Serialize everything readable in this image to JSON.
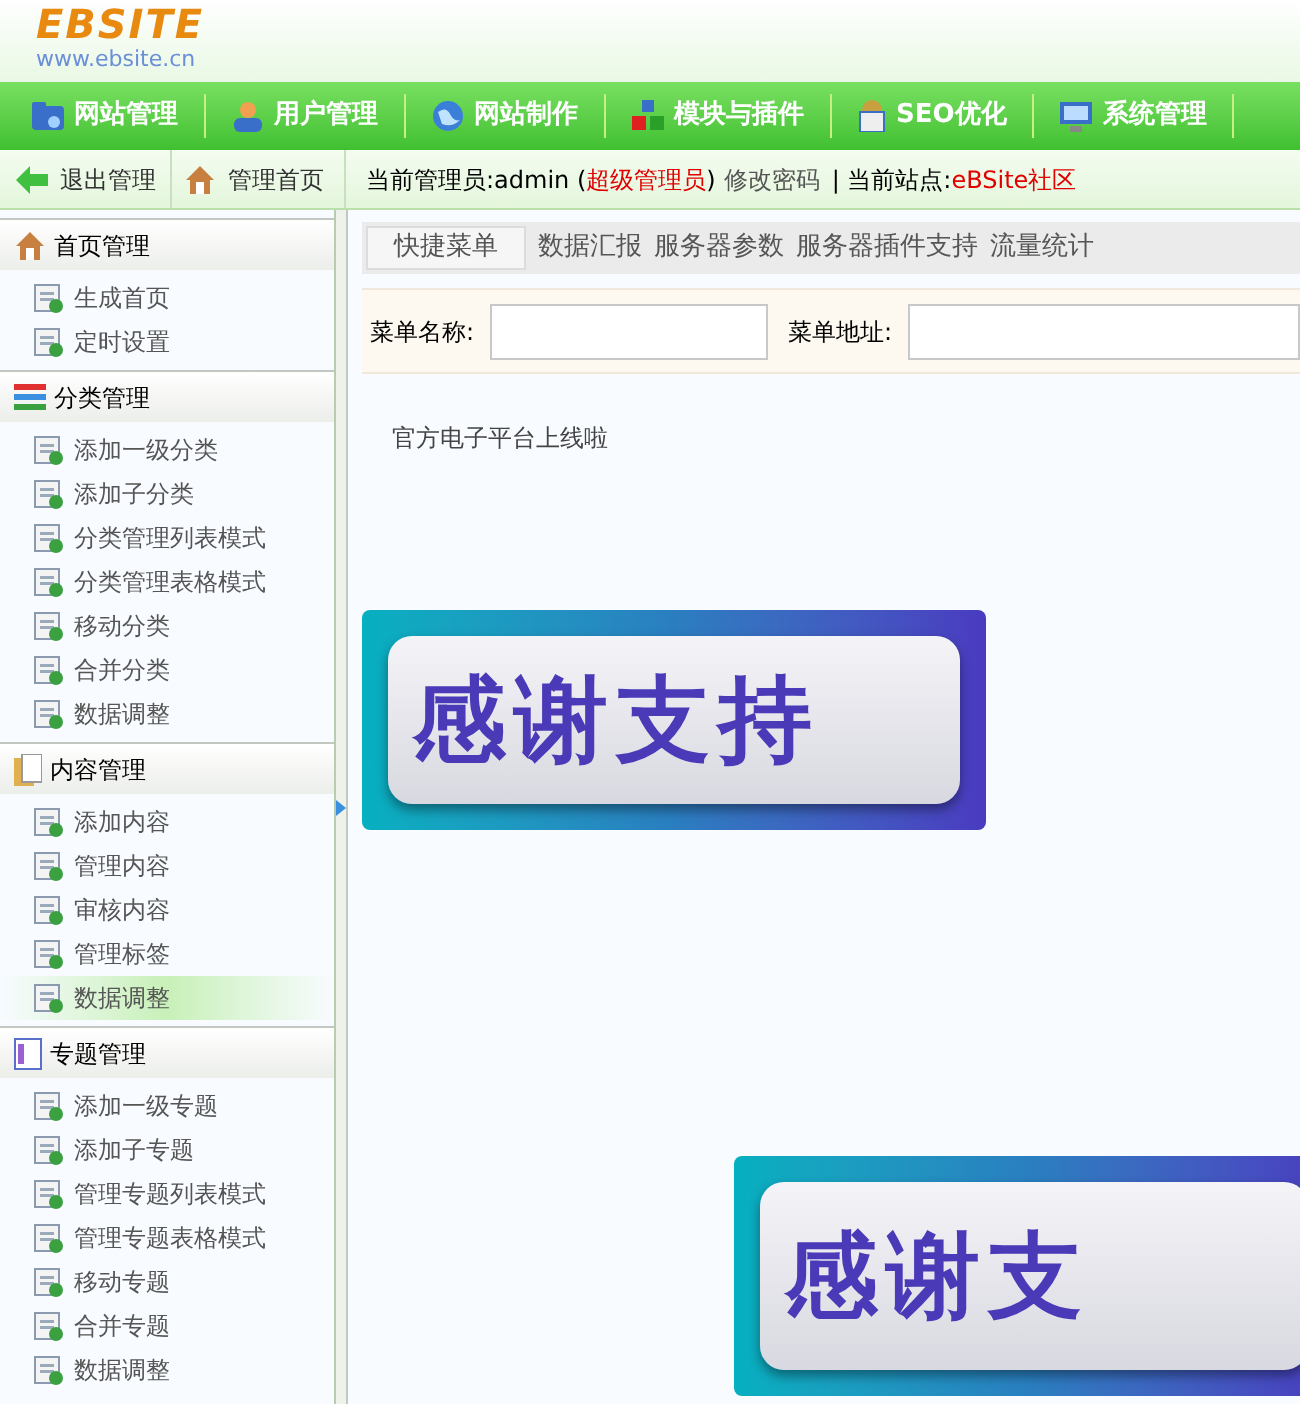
{
  "logo": {
    "name": "EBSITE",
    "url": "www.ebsite.cn"
  },
  "nav": [
    {
      "label": "网站管理"
    },
    {
      "label": "用户管理"
    },
    {
      "label": "网站制作"
    },
    {
      "label": "模块与插件"
    },
    {
      "label": "SEO优化"
    },
    {
      "label": "系统管理"
    }
  ],
  "subbar": {
    "logout": "退出管理",
    "home": "管理首页",
    "admin_label": "当前管理员:admin (",
    "admin_role": "超级管理员",
    "admin_close": ")",
    "change_password": "修改密码",
    "site_label": "| 当前站点:",
    "site_name": "eBSite社区"
  },
  "sidebar": [
    {
      "title": "首页管理",
      "items": [
        {
          "label": "生成首页",
          "selected": false
        },
        {
          "label": "定时设置",
          "selected": false
        }
      ]
    },
    {
      "title": "分类管理",
      "items": [
        {
          "label": "添加一级分类",
          "selected": false
        },
        {
          "label": "添加子分类",
          "selected": false
        },
        {
          "label": "分类管理列表模式",
          "selected": false
        },
        {
          "label": "分类管理表格模式",
          "selected": false
        },
        {
          "label": "移动分类",
          "selected": false
        },
        {
          "label": "合并分类",
          "selected": false
        },
        {
          "label": "数据调整",
          "selected": false
        }
      ]
    },
    {
      "title": "内容管理",
      "items": [
        {
          "label": "添加内容",
          "selected": false
        },
        {
          "label": "管理内容",
          "selected": false
        },
        {
          "label": "审核内容",
          "selected": false
        },
        {
          "label": "管理标签",
          "selected": false
        },
        {
          "label": "数据调整",
          "selected": true
        }
      ]
    },
    {
      "title": "专题管理",
      "items": [
        {
          "label": "添加一级专题",
          "selected": false
        },
        {
          "label": "添加子专题",
          "selected": false
        },
        {
          "label": "管理专题列表模式",
          "selected": false
        },
        {
          "label": "管理专题表格模式",
          "selected": false
        },
        {
          "label": "移动专题",
          "selected": false
        },
        {
          "label": "合并专题",
          "selected": false
        },
        {
          "label": "数据调整",
          "selected": false
        }
      ]
    }
  ],
  "tabs": [
    {
      "label": "快捷菜单",
      "selected": true
    },
    {
      "label": "数据汇报",
      "selected": false
    },
    {
      "label": "服务器参数",
      "selected": false
    },
    {
      "label": "服务器插件支持",
      "selected": false
    },
    {
      "label": "流量统计",
      "selected": false
    }
  ],
  "form": {
    "name_label": "菜单名称:",
    "url_label": "菜单地址:"
  },
  "notice": "官方电子平台上线啦",
  "banners": [
    {
      "text": "感谢支持"
    },
    {
      "text": "感谢支"
    }
  ]
}
